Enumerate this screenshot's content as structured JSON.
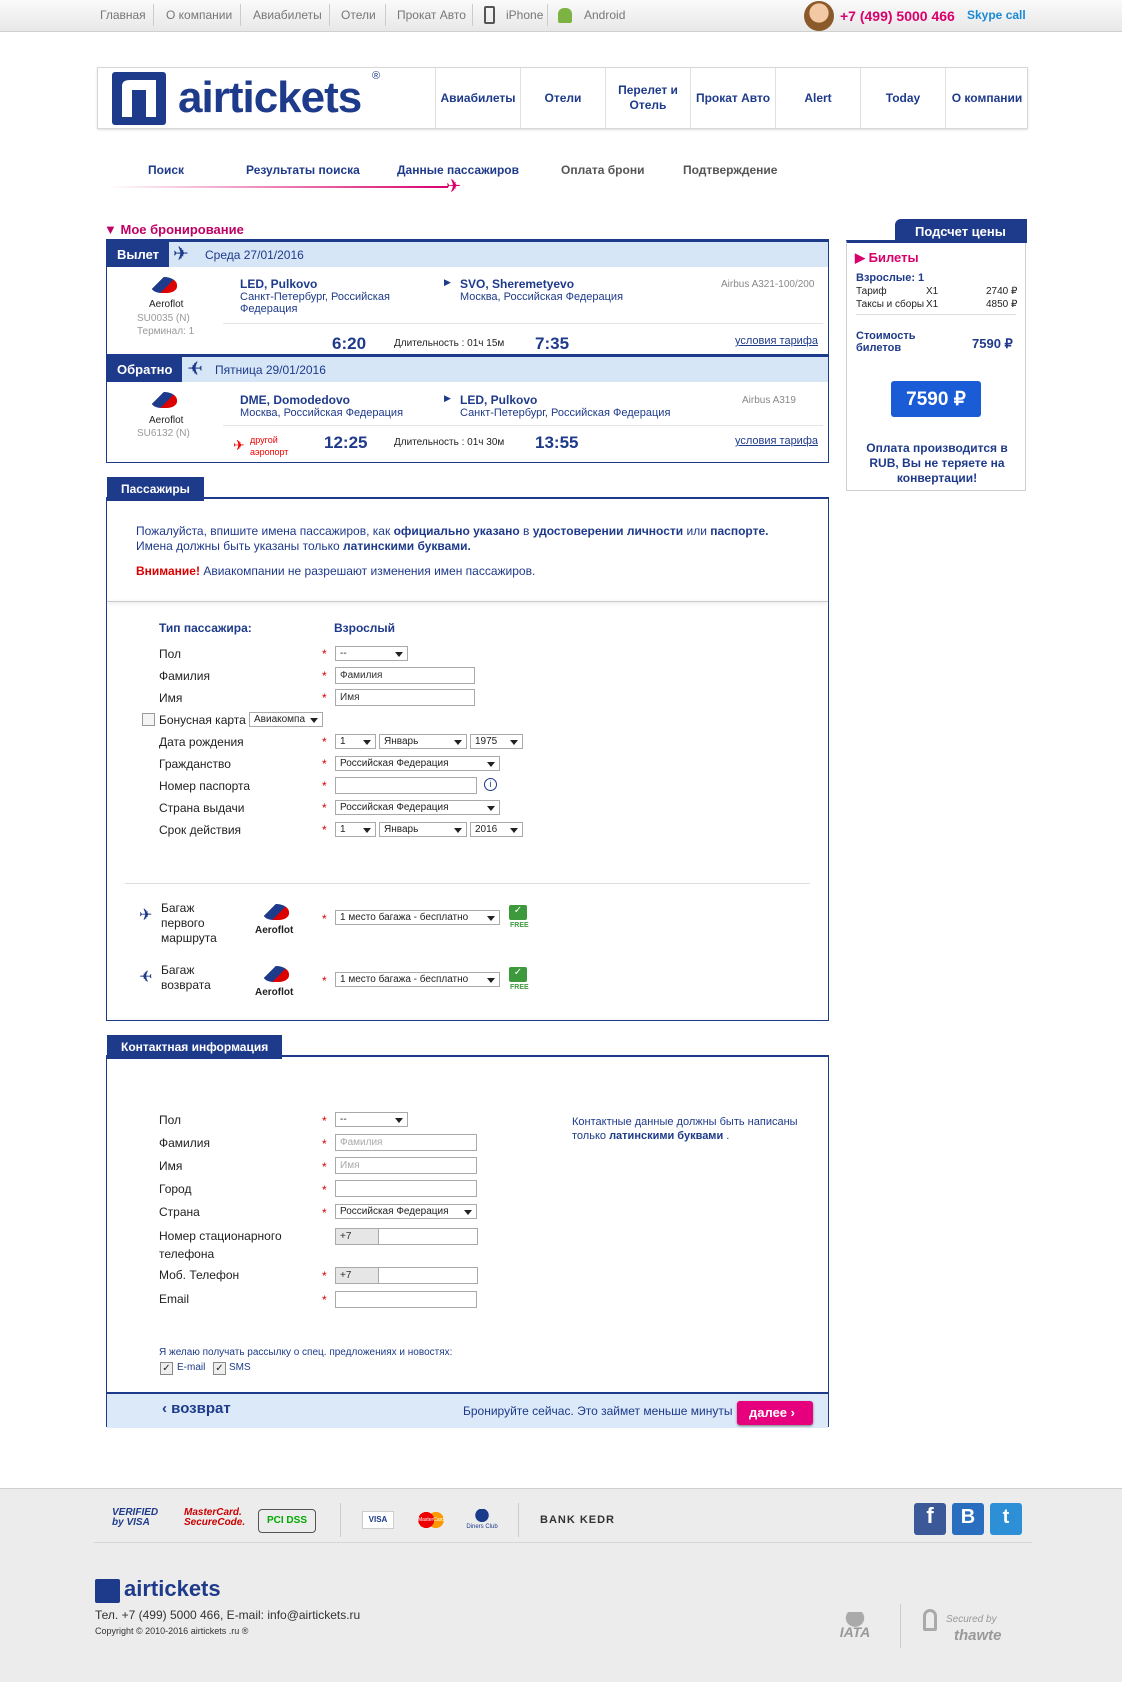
{
  "topnav": {
    "items": [
      "Главная",
      "О компании",
      "Авиабилеты",
      "Отели",
      "Прокат Авто",
      "iPhone",
      "Android"
    ],
    "phone": "+7 (499) 5000 466",
    "skype": "Skype call"
  },
  "header": {
    "logo": "airtickets",
    "logo_reg": "®",
    "nav": [
      "Авиабилеты",
      "Отели",
      "Перелет и Отель",
      "Прокат Авто",
      "Alert",
      "Today",
      "О компании"
    ]
  },
  "steps": [
    "Поиск",
    "Результаты поиска",
    "Данные пассажиров",
    "Оплата брони",
    "Подтверждение"
  ],
  "booking": {
    "title": "Мое бронирование",
    "outbound": {
      "tag": "Вылет",
      "date": "Среда 27/01/2016",
      "airline": "Aeroflot",
      "flight": "SU0035  (N)",
      "terminal": "Терминал: 1",
      "from_code": "LED, Pulkovo",
      "from_city": "Санкт-Петербург, Российская Федерация",
      "to_code": "SVO, Sheremetyevo",
      "to_city": "Москва, Российская Федерация",
      "aircraft": "Airbus A321-100/200",
      "dep_time": "6:20",
      "duration": "Длительность : 01ч 15м",
      "arr_time": "7:35",
      "fare_link": "условия тарифа"
    },
    "inbound": {
      "tag": "Обратно",
      "date": "Пятница 29/01/2016",
      "airline": "Aeroflot",
      "flight": "SU6132  (N)",
      "other_airport": "другой аэропорт",
      "from_code": "DME, Domodedovo",
      "from_city": "Москва, Российская Федерация",
      "to_code": "LED, Pulkovo",
      "to_city": "Санкт-Петербург, Российская Федерация",
      "aircraft": "Airbus A319",
      "dep_time": "12:25",
      "duration": "Длительность : 01ч 30м",
      "arr_time": "13:55",
      "fare_link": "условия тарифа"
    }
  },
  "price": {
    "title": "Подсчет цены",
    "tickets": "Билеты",
    "adults": "Взрослые: 1",
    "tariff_label": "Тариф",
    "tariff_qty": "X1",
    "tariff_value": "2740 ₽",
    "taxes_label": "Таксы и сборы",
    "taxes_qty": "X1",
    "taxes_value": "4850 ₽",
    "cost_label": "Стоимость билетов",
    "cost_value": "7590 ₽",
    "total": "7590 ₽",
    "note": "Оплата производится в RUB, Вы не теряете на конвертации!"
  },
  "passengers": {
    "tab": "Пассажиры",
    "info_1a": "Пожалуйста, впишите имена пассажиров, как ",
    "info_1b": "официально указано",
    "info_1c": " в ",
    "info_1d": "удостоверении личности",
    "info_1e": " или ",
    "info_1f": "паспорте.",
    "info_2a": "Имена должны быть указаны только ",
    "info_2b": "латинскими буквами.",
    "warn_a": "Внимание!",
    "warn_b": " Авиакомпании не разрешают изменения имен пассажиров.",
    "type_label": "Тип пассажира:",
    "type_value": "Взрослый",
    "gender": "Пол",
    "gender_value": "--",
    "surname": "Фамилия",
    "surname_value": "Фамилия",
    "name": "Имя",
    "name_value": "Имя",
    "bonus": "Бонусная карта",
    "bonus_value": "Авиакомпа",
    "dob": "Дата рождения",
    "dob_day": "1",
    "dob_month": "Январь",
    "dob_year": "1975",
    "citizenship": "Гражданство",
    "citizenship_value": "Российская Федерация",
    "passport": "Номер паспорта",
    "issue_country": "Страна выдачи",
    "issue_value": "Российская Федерация",
    "expiry": "Срок действия",
    "exp_day": "1",
    "exp_month": "Январь",
    "exp_year": "2016",
    "bag1_label": "Багаж первого маршрута",
    "bag2_label": "Багаж возврата",
    "airline": "Aeroflot",
    "bag_value": "1 место багажа - бесплатно",
    "free": "FREE"
  },
  "contact": {
    "tab": "Контактная информация",
    "gender": "Пол",
    "gender_value": "--",
    "surname": "Фамилия",
    "surname_ph": "Фамилия",
    "name": "Имя",
    "name_ph": "Имя",
    "city": "Город",
    "country": "Страна",
    "country_value": "Российская Федерация",
    "landline": "Номер стационарного телефона",
    "landline_code": "+7",
    "mobile": "Моб. Телефон",
    "mobile_code": "+7",
    "email": "Email",
    "note_a": "Контактные данные должны быть написаны только ",
    "note_b": "латинскими буквами",
    "note_c": " .",
    "newsletter": "Я желаю получать рассылку о спец. предложениях и новостях:",
    "opt_email": "E-mail",
    "opt_sms": "SMS",
    "back": "возврат",
    "cta": "Бронируйте сейчас. Это займет меньше минуты",
    "next": "далее"
  },
  "footer": {
    "badges": [
      "VERIFIED by VISA",
      "MasterCard. SecureCode.",
      "PCI DSS",
      "VISA",
      "MasterCard",
      "Diners Club",
      "BANK KEDR"
    ],
    "logo": "airtickets",
    "contacts": "Тел. +7 (499) 5000 466, E-mail:  info@airtickets.ru",
    "copyright": "Copyright © 2010-2016 airtickets .ru ®",
    "iata": "IATA",
    "secured_by": "Secured by",
    "thawte": "thawte"
  },
  "colors": {
    "brand": "#1e3a8a",
    "accent": "#e6007e"
  }
}
